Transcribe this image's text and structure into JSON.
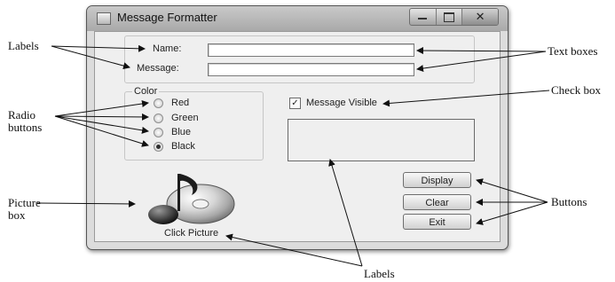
{
  "window": {
    "title": "Message Formatter",
    "controls": {
      "minimize_icon": "minimize-icon",
      "maximize_icon": "maximize-icon",
      "close_glyph": "✕"
    }
  },
  "form": {
    "name_label": "Name:",
    "message_label": "Message:",
    "name_value": "",
    "message_value": "",
    "color_group_title": "Color",
    "radios": [
      {
        "label": "Red",
        "checked": false
      },
      {
        "label": "Green",
        "checked": false
      },
      {
        "label": "Blue",
        "checked": false
      },
      {
        "label": "Black",
        "checked": true
      }
    ],
    "checkbox": {
      "label": "Message Visible",
      "checked": true
    },
    "buttons": {
      "display": "Display",
      "clear": "Clear",
      "exit": "Exit"
    },
    "picture_caption": "Click Picture"
  },
  "callouts": {
    "labels_top": "Labels",
    "radio_buttons_line1": "Radio",
    "radio_buttons_line2": "buttons",
    "picture_box_line1": "Picture",
    "picture_box_line2": "box",
    "text_boxes": "Text boxes",
    "check_box": "Check box",
    "buttons": "Buttons",
    "labels_bottom": "Labels"
  },
  "colors": {
    "window_frame": "#a9a9a9",
    "client_background": "#efefef",
    "arrow": "#111111"
  }
}
